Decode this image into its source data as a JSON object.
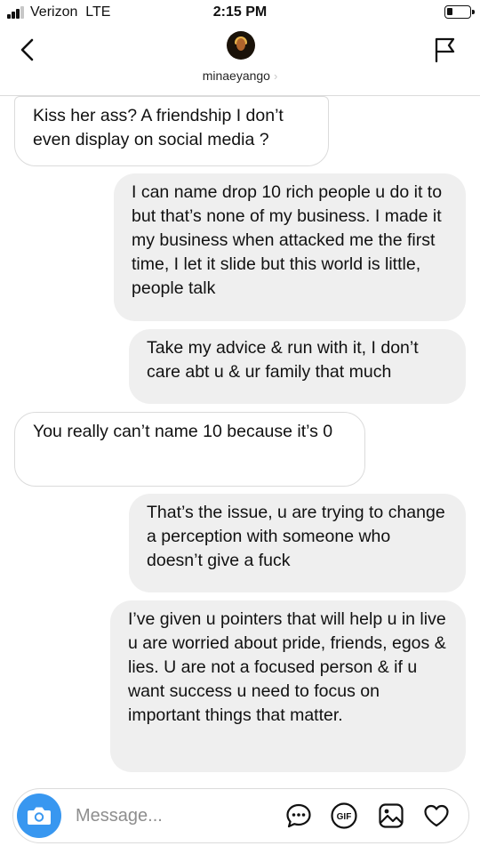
{
  "status_bar": {
    "carrier": "Verizon",
    "network": "LTE",
    "time": "2:15 PM",
    "battery_level": 0.25
  },
  "header": {
    "username": "minaeyango",
    "chevron": "›"
  },
  "messages": [
    {
      "direction": "received",
      "text": "Kiss her ass? A friendship I don’t even display on social media ?"
    },
    {
      "direction": "sent",
      "text": "I can name drop 10 rich people u do it to but that’s none of my business. I made it my business when attacked me the first  time, I let it slide but this world is little, people talk"
    },
    {
      "direction": "sent",
      "text": "Take my advice & run with it, I don’t care abt u & ur family that much"
    },
    {
      "direction": "received",
      "text": "You really can’t name 10 because it’s 0"
    },
    {
      "direction": "sent",
      "text": "That’s the issue, u are trying to change a perception with someone who doesn’t give a fuck"
    },
    {
      "direction": "sent",
      "text": "I’ve given u pointers that will help u in live u are worried about pride, friends, egos & lies. U are not a focused person & if u want success u need to focus on important things that matter."
    }
  ],
  "composer": {
    "placeholder": "Message...",
    "gif_label": "GIF",
    "accent_color": "#3897f0"
  },
  "icons": {
    "back": "chevron-left-icon",
    "flag": "flag-icon",
    "camera": "camera-icon",
    "more": "chat-dots-icon",
    "gif": "gif-icon",
    "gallery": "image-icon",
    "like": "heart-icon"
  }
}
